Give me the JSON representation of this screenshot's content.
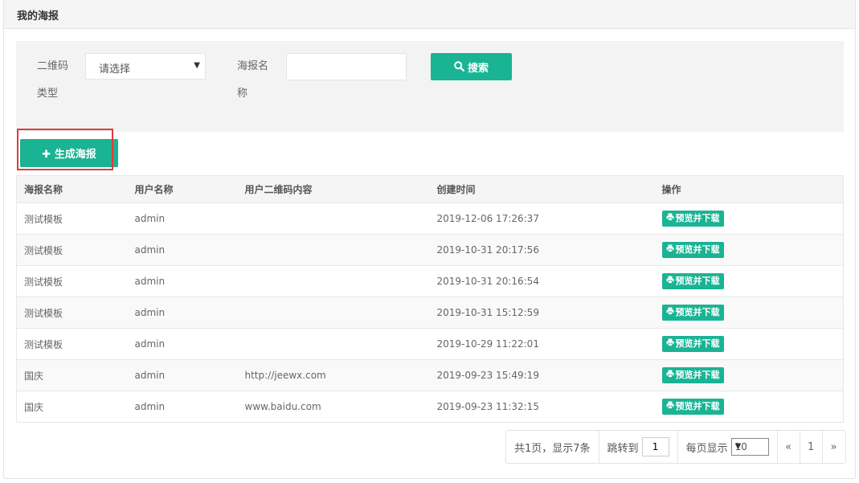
{
  "panel": {
    "title": "我的海报"
  },
  "search": {
    "qr_type_label_line1": "二维码",
    "qr_type_label_line2": "类型",
    "qr_type_selected": "请选择",
    "poster_name_label_line1": "海报名",
    "poster_name_label_line2": "称",
    "poster_name_value": "",
    "search_label": "搜索"
  },
  "toolbar": {
    "create_label": "生成海报"
  },
  "table": {
    "columns": [
      "海报名称",
      "用户名称",
      "用户二维码内容",
      "创建时间",
      "操作"
    ],
    "action_label": "预览并下载",
    "rows": [
      {
        "name": "测试模板",
        "user": "admin",
        "qr": "",
        "created": "2019-12-06 17:26:37"
      },
      {
        "name": "测试模板",
        "user": "admin",
        "qr": "",
        "created": "2019-10-31 20:17:56"
      },
      {
        "name": "测试模板",
        "user": "admin",
        "qr": "",
        "created": "2019-10-31 20:16:54"
      },
      {
        "name": "测试模板",
        "user": "admin",
        "qr": "",
        "created": "2019-10-31 15:12:59"
      },
      {
        "name": "测试模板",
        "user": "admin",
        "qr": "",
        "created": "2019-10-29 11:22:01"
      },
      {
        "name": "国庆",
        "user": "admin",
        "qr": "http://jeewx.com",
        "created": "2019-09-23 15:49:19"
      },
      {
        "name": "国庆",
        "user": "admin",
        "qr": "www.baidu.com",
        "created": "2019-09-23 11:32:15"
      }
    ]
  },
  "pagination": {
    "summary": "共1页，显示7条",
    "jump_label": "跳转到",
    "jump_value": "1",
    "page_size_label": "每页显示",
    "page_size_value": "10",
    "prev": "«",
    "current_page": "1",
    "next": "»"
  },
  "colors": {
    "accent": "#1ab394",
    "highlight": "#e03a3a"
  }
}
